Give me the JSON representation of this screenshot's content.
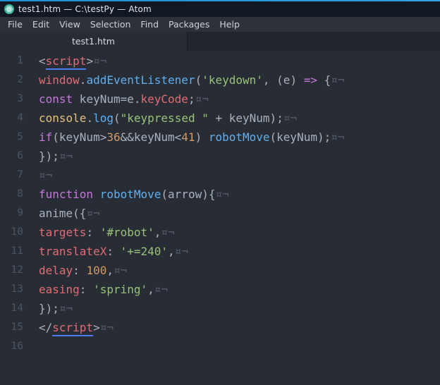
{
  "window": {
    "title": "test1.htm — C:\\testPy — Atom"
  },
  "menu": {
    "items": [
      "File",
      "Edit",
      "View",
      "Selection",
      "Find",
      "Packages",
      "Help"
    ]
  },
  "tabs": {
    "active_label": "test1.htm"
  },
  "colors": {
    "editor_bg": "#282c34",
    "accent_blue": "#1e8fd5",
    "keyword_purple": "#c678dd",
    "tag_red": "#e06c75",
    "function_blue": "#61afef",
    "string_green": "#98c379",
    "number_orange": "#d19a66",
    "support_yellow": "#e5c07b",
    "default_text": "#abb2bf",
    "invisible_gray": "#565d6d",
    "tag_underline": "#4e7bf0"
  },
  "editor": {
    "invisible_eol": "¤¬",
    "lines": [
      {
        "num": 1,
        "tokens": [
          {
            "t": "<",
            "c": "d"
          },
          {
            "t": "script",
            "c": "tag"
          },
          {
            "t": ">",
            "c": "d"
          },
          {
            "t": "¤¬",
            "c": "inv"
          }
        ]
      },
      {
        "num": 2,
        "tokens": [
          {
            "t": "window",
            "c": "red"
          },
          {
            "t": ".",
            "c": "d"
          },
          {
            "t": "addEventListener",
            "c": "blue"
          },
          {
            "t": "(",
            "c": "d"
          },
          {
            "t": "'keydown'",
            "c": "green"
          },
          {
            "t": ", (e) ",
            "c": "d"
          },
          {
            "t": "=>",
            "c": "purple"
          },
          {
            "t": " {",
            "c": "d"
          },
          {
            "t": "¤¬",
            "c": "inv"
          }
        ]
      },
      {
        "num": 3,
        "tokens": [
          {
            "t": "const",
            "c": "purple"
          },
          {
            "t": " keyNum=e.",
            "c": "d"
          },
          {
            "t": "keyCode",
            "c": "red"
          },
          {
            "t": ";",
            "c": "d"
          },
          {
            "t": "¤¬",
            "c": "inv"
          }
        ]
      },
      {
        "num": 4,
        "tokens": [
          {
            "t": "console",
            "c": "yellow"
          },
          {
            "t": ".",
            "c": "d"
          },
          {
            "t": "log",
            "c": "blue"
          },
          {
            "t": "(",
            "c": "d"
          },
          {
            "t": "\"keypressed \"",
            "c": "green"
          },
          {
            "t": " + keyNum);",
            "c": "d"
          },
          {
            "t": "¤¬",
            "c": "inv"
          }
        ]
      },
      {
        "num": 5,
        "tokens": [
          {
            "t": "if",
            "c": "purple"
          },
          {
            "t": "(keyNum>",
            "c": "d"
          },
          {
            "t": "36",
            "c": "orange"
          },
          {
            "t": "&&keyNum<",
            "c": "d"
          },
          {
            "t": "41",
            "c": "orange"
          },
          {
            "t": ") ",
            "c": "d"
          },
          {
            "t": "robotMove",
            "c": "blue"
          },
          {
            "t": "(keyNum);",
            "c": "d"
          },
          {
            "t": "¤¬",
            "c": "inv"
          }
        ]
      },
      {
        "num": 6,
        "tokens": [
          {
            "t": "});",
            "c": "d"
          },
          {
            "t": "¤¬",
            "c": "inv"
          }
        ]
      },
      {
        "num": 7,
        "tokens": [
          {
            "t": "¤¬",
            "c": "inv"
          }
        ]
      },
      {
        "num": 8,
        "tokens": [
          {
            "t": "function",
            "c": "purple"
          },
          {
            "t": " ",
            "c": "d"
          },
          {
            "t": "robotMove",
            "c": "blue"
          },
          {
            "t": "(arrow){",
            "c": "d"
          },
          {
            "t": "¤¬",
            "c": "inv"
          }
        ]
      },
      {
        "num": 9,
        "tokens": [
          {
            "t": "anime({",
            "c": "d"
          },
          {
            "t": "¤¬",
            "c": "inv"
          }
        ]
      },
      {
        "num": 10,
        "tokens": [
          {
            "t": "targets",
            "c": "red"
          },
          {
            "t": ": ",
            "c": "d"
          },
          {
            "t": "'#robot'",
            "c": "green"
          },
          {
            "t": ",",
            "c": "d"
          },
          {
            "t": "¤¬",
            "c": "inv"
          }
        ]
      },
      {
        "num": 11,
        "tokens": [
          {
            "t": "translateX",
            "c": "red"
          },
          {
            "t": ": ",
            "c": "d"
          },
          {
            "t": "'+=240'",
            "c": "green"
          },
          {
            "t": ",",
            "c": "d"
          },
          {
            "t": "¤¬",
            "c": "inv"
          }
        ]
      },
      {
        "num": 12,
        "tokens": [
          {
            "t": "delay",
            "c": "red"
          },
          {
            "t": ": ",
            "c": "d"
          },
          {
            "t": "100",
            "c": "orange"
          },
          {
            "t": ",",
            "c": "d"
          },
          {
            "t": "¤¬",
            "c": "inv"
          }
        ]
      },
      {
        "num": 13,
        "tokens": [
          {
            "t": "easing",
            "c": "red"
          },
          {
            "t": ": ",
            "c": "d"
          },
          {
            "t": "'spring'",
            "c": "green"
          },
          {
            "t": ",",
            "c": "d"
          },
          {
            "t": "¤¬",
            "c": "inv"
          }
        ]
      },
      {
        "num": 14,
        "tokens": [
          {
            "t": "});",
            "c": "d"
          },
          {
            "t": "¤¬",
            "c": "inv"
          }
        ]
      },
      {
        "num": 15,
        "tokens": [
          {
            "t": "</",
            "c": "d"
          },
          {
            "t": "script",
            "c": "tag"
          },
          {
            "t": ">",
            "c": "d"
          },
          {
            "t": "¤¬",
            "c": "inv"
          }
        ]
      },
      {
        "num": 16,
        "tokens": []
      }
    ]
  }
}
